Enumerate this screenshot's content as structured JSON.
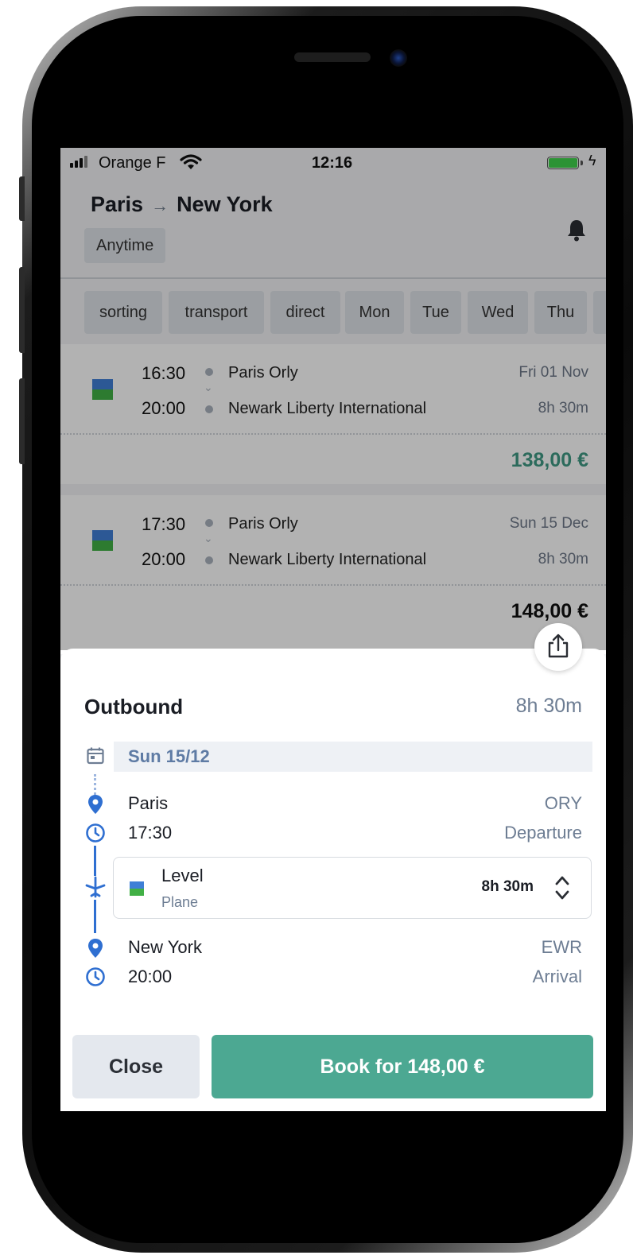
{
  "status_bar": {
    "carrier": "Orange F",
    "time": "12:16"
  },
  "header": {
    "origin": "Paris",
    "arrow": "→",
    "destination": "New York",
    "date_filter": "Anytime"
  },
  "filters": [
    "sorting",
    "transport",
    "direct",
    "Mon",
    "Tue",
    "Wed",
    "Thu"
  ],
  "results": [
    {
      "dep_time": "16:30",
      "arr_time": "20:00",
      "dep_station": "Paris Orly",
      "arr_station": "Newark Liberty International",
      "date": "Fri 01 Nov",
      "duration": "8h 30m",
      "price": "138,00 €",
      "price_color": "#3f9a84"
    },
    {
      "dep_time": "17:30",
      "arr_time": "20:00",
      "dep_station": "Paris Orly",
      "arr_station": "Newark Liberty International",
      "date": "Sun 15 Dec",
      "duration": "8h 30m",
      "price": "148,00 €",
      "price_color": "#111111"
    }
  ],
  "sheet": {
    "title": "Outbound",
    "duration": "8h 30m",
    "date": "Sun 15/12",
    "departure": {
      "city": "Paris",
      "time": "17:30",
      "code": "ORY",
      "label": "Departure"
    },
    "segment": {
      "operator": "Level",
      "mode": "Plane",
      "duration": "8h 30m"
    },
    "arrival": {
      "city": "New York",
      "time": "20:00",
      "code": "EWR",
      "label": "Arrival"
    },
    "close_label": "Close",
    "book_label": "Book for 148,00 €"
  },
  "colors": {
    "accent": "#4ca892",
    "timeline_blue": "#2f6fd1"
  },
  "icons": [
    "signal-icon",
    "wifi-icon",
    "battery-icon",
    "bell-icon",
    "share-icon",
    "calendar-icon",
    "pin-icon",
    "clock-icon",
    "plane-icon",
    "chevron-updown-icon"
  ]
}
